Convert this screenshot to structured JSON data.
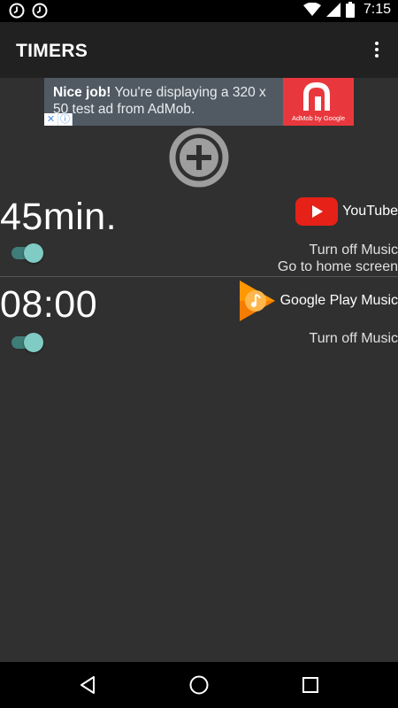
{
  "status_bar": {
    "time": "7:15",
    "left_icons": [
      "alarm-icon",
      "alarm-icon"
    ],
    "right_icons": [
      "wifi-icon",
      "cell-signal-icon",
      "battery-icon"
    ]
  },
  "app_bar": {
    "title": "TIMERS",
    "menu_icon": "overflow-menu-icon"
  },
  "ad": {
    "bold": "Nice job!",
    "text": " You're displaying a 320 x 50 test ad from AdMob.",
    "logo_text": "AdMob by Google",
    "accent_color": "#e8383d"
  },
  "add_button": {
    "icon": "add-circle-icon"
  },
  "timers": [
    {
      "time": "45min.",
      "enabled": true,
      "app_name": "YouTube",
      "app_icon": "youtube-icon",
      "actions": [
        "Turn off Music",
        "Go to home screen"
      ]
    },
    {
      "time": "08:00",
      "enabled": true,
      "app_name": "Google Play Music",
      "app_icon": "google-play-music-icon",
      "actions": [
        "Turn off Music"
      ]
    }
  ],
  "nav_bar": {
    "buttons": [
      "back-icon",
      "home-icon",
      "recents-icon"
    ]
  },
  "colors": {
    "background": "#303030",
    "app_bar": "#212121",
    "toggle_thumb": "#80cbc4",
    "toggle_track": "#3f7d78"
  }
}
